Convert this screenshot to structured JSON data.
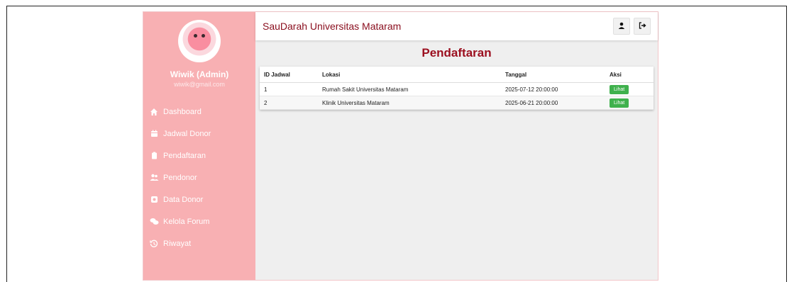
{
  "app_title": "SauDarah Universitas Mataram",
  "user": {
    "name": "Wiwik (Admin)",
    "email": "wiwik@gmail.com"
  },
  "sidebar": {
    "items": [
      {
        "label": "Dashboard",
        "icon": "home-icon"
      },
      {
        "label": "Jadwal Donor",
        "icon": "calendar-icon"
      },
      {
        "label": "Pendaftaran",
        "icon": "clipboard-icon"
      },
      {
        "label": "Pendonor",
        "icon": "users-icon"
      },
      {
        "label": "Data Donor",
        "icon": "database-icon"
      },
      {
        "label": "Kelola Forum",
        "icon": "forum-icon"
      },
      {
        "label": "Riwayat",
        "icon": "history-icon"
      }
    ]
  },
  "page": {
    "title": "Pendaftaran"
  },
  "table": {
    "headers": [
      "ID Jadwal",
      "Lokasi",
      "Tanggal",
      "Aksi"
    ],
    "rows": [
      {
        "id": "1",
        "lokasi": "Rumah Sakit Universitas Mataram",
        "tanggal": "2025-07-12 20:00:00",
        "aksi": "Lihat"
      },
      {
        "id": "2",
        "lokasi": "Klinik Universitas Mataram",
        "tanggal": "2025-06-21 20:00:00",
        "aksi": "Lihat"
      }
    ]
  },
  "colors": {
    "sidebar_bg": "#f8b0b3",
    "accent": "#9b0f1f",
    "button_green": "#3fb14d"
  }
}
